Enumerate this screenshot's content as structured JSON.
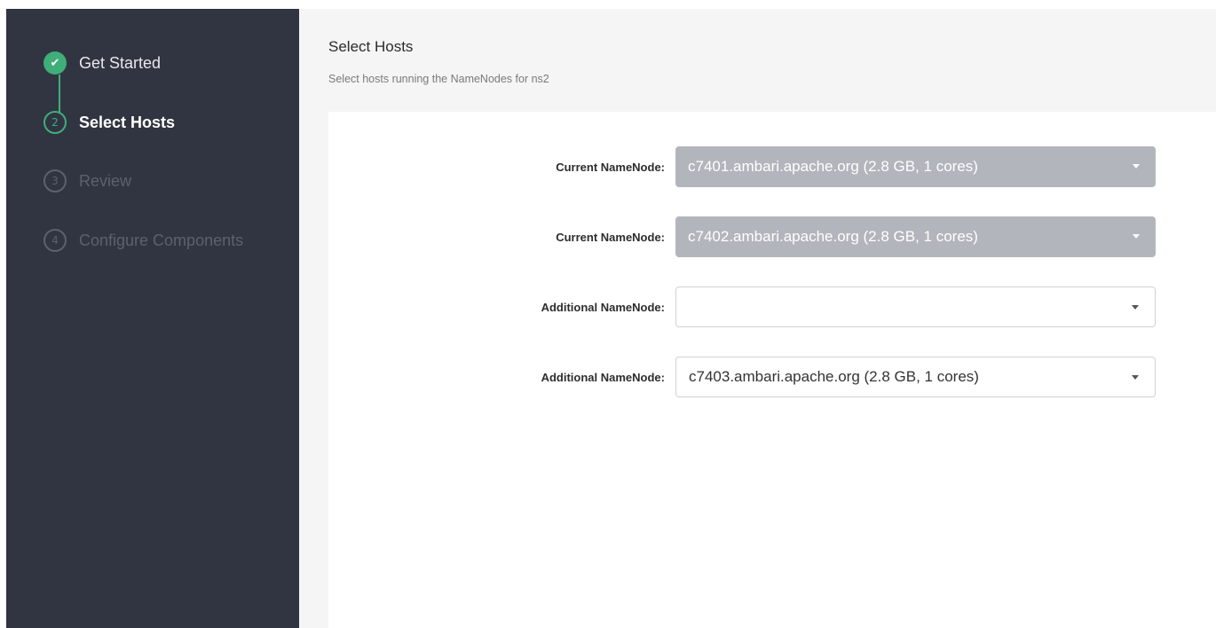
{
  "wizard": {
    "steps": [
      {
        "number": "✔",
        "label": "Get Started",
        "state": "done"
      },
      {
        "number": "2",
        "label": "Select Hosts",
        "state": "active"
      },
      {
        "number": "3",
        "label": "Review",
        "state": "pending"
      },
      {
        "number": "4",
        "label": "Configure Components",
        "state": "pending"
      }
    ]
  },
  "header": {
    "title": "Select Hosts",
    "subtitle": "Select hosts running the NameNodes for ns2"
  },
  "form": {
    "rows": [
      {
        "label": "Current NameNode:",
        "value": "c7401.ambari.apache.org (2.8 GB, 1 cores)",
        "disabled": true
      },
      {
        "label": "Current NameNode:",
        "value": "c7402.ambari.apache.org (2.8 GB, 1 cores)",
        "disabled": true
      },
      {
        "label": "Additional NameNode:",
        "value": "",
        "disabled": false
      },
      {
        "label": "Additional NameNode:",
        "value": "c7403.ambari.apache.org (2.8 GB, 1 cores)",
        "disabled": false
      }
    ]
  },
  "colors": {
    "sidebar_bg": "#313541",
    "accent_green": "#3fae79",
    "disabled_select_bg": "#b2b5bc"
  },
  "icons": {
    "step_done": "check-icon",
    "select_caret": "caret-down-icon"
  }
}
